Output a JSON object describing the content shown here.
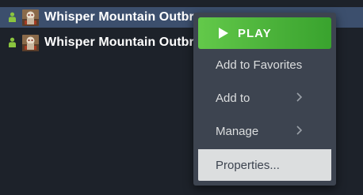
{
  "library": {
    "rows": [
      {
        "title": "Whisper Mountain Outbr",
        "status_icon": "user-online-icon",
        "thumbnail": "game-thumbnail"
      },
      {
        "title": "Whisper Mountain Outbr",
        "status_icon": "user-online-icon",
        "thumbnail": "game-thumbnail"
      }
    ]
  },
  "context_menu": {
    "play_label": "PLAY",
    "items": [
      {
        "label": "Add to Favorites"
      },
      {
        "label": "Add to",
        "submenu": true
      },
      {
        "label": "Manage",
        "submenu": true
      },
      {
        "label": "Properties..."
      }
    ]
  },
  "colors": {
    "background": "#1d222a",
    "selected_row": "#3c4f6d",
    "menu_background": "#3d4450",
    "play_green": "#4bb23a",
    "hover_item": "#dcdedf",
    "status_green": "#8bc53f"
  }
}
